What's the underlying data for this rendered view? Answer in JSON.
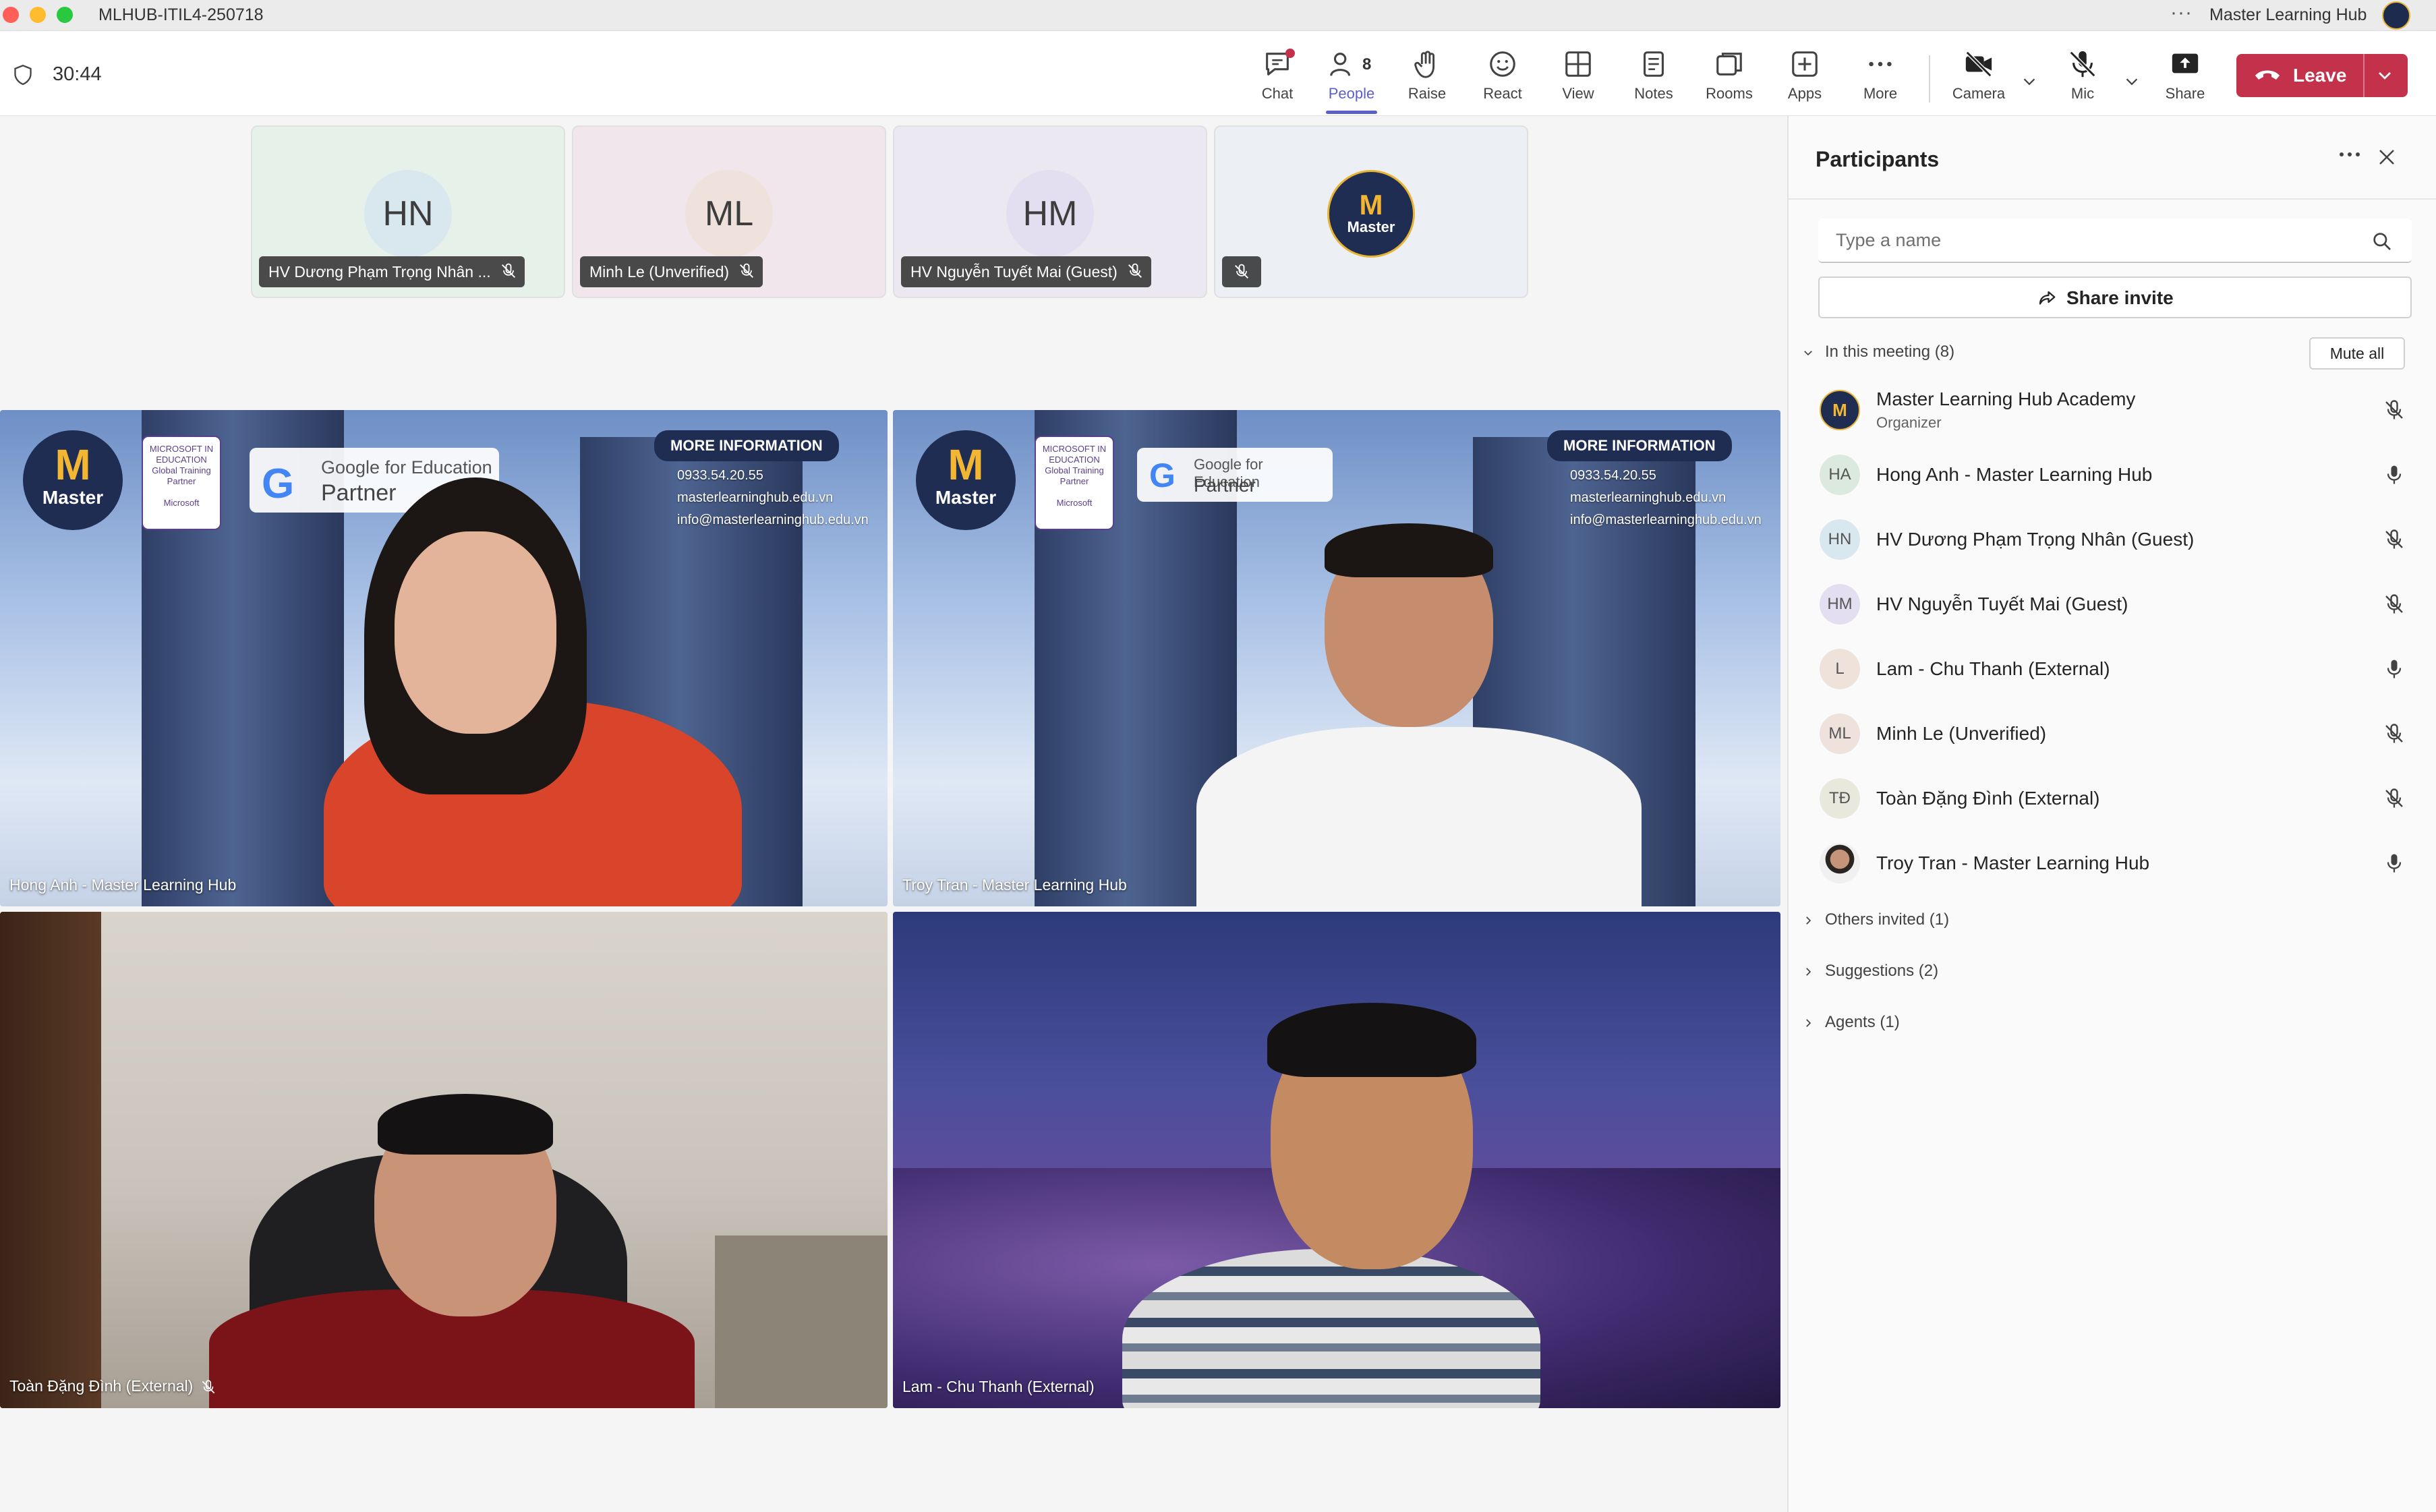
{
  "window": {
    "title": "MLHUB-ITIL4-250718",
    "org_name": "Master Learning Hub"
  },
  "toolbar": {
    "timer": "30:44",
    "chat_label": "Chat",
    "people_label": "People",
    "people_count": "8",
    "raise_label": "Raise",
    "react_label": "React",
    "view_label": "View",
    "notes_label": "Notes",
    "rooms_label": "Rooms",
    "apps_label": "Apps",
    "more_label": "More",
    "camera_label": "Camera",
    "mic_label": "Mic",
    "share_label": "Share",
    "leave_label": "Leave",
    "leave_color": "#c4314b",
    "accent_color": "#5b5fc7"
  },
  "small_tiles": [
    {
      "initials": "HN",
      "name": "HV Dương Phạm Trọng Nhân ...",
      "bg": "#e6f1e9"
    },
    {
      "initials": "ML",
      "name": "Minh Le (Unverified)",
      "bg": "#f1e6ec"
    },
    {
      "initials": "HM",
      "name": "HV Nguyễn Tuyết Mai (Guest)",
      "bg": "#ece8f1"
    },
    {
      "initials": "",
      "name": "",
      "bg": "#eceff3"
    }
  ],
  "logo_text": {
    "m": "M",
    "word": "Master"
  },
  "branding": {
    "badge_text": "MICROSOFT IN EDUCATION Global Training Partner",
    "badge_footer": "Microsoft",
    "gfe_line1": "Google for Education",
    "gfe_line2": "Partner",
    "info_header": "MORE INFORMATION",
    "phone": "0933.54.20.55",
    "website": "masterlearninghub.edu.vn",
    "email": "info@masterlearninghub.edu.vn"
  },
  "videos": [
    {
      "label": "Hong Anh - Master Learning Hub"
    },
    {
      "label": "Troy Tran - Master Learning Hub"
    },
    {
      "label": "Toàn Đặng Đình (External)"
    },
    {
      "label": "Lam - Chu Thanh (External)"
    }
  ],
  "panel": {
    "title": "Participants",
    "search_placeholder": "Type a name",
    "share_invite_label": "Share invite",
    "in_meeting_label": "In this meeting (8)",
    "mute_all_label": "Mute all",
    "participants": [
      {
        "initials": "",
        "name": "Master Learning Hub Academy",
        "role": "Organizer",
        "mic": "muted"
      },
      {
        "initials": "HA",
        "name": "Hong Anh - Master Learning Hub",
        "role": "",
        "mic": "on"
      },
      {
        "initials": "HN",
        "name": "HV Dương Phạm Trọng Nhân (Guest)",
        "role": "",
        "mic": "muted"
      },
      {
        "initials": "HM",
        "name": "HV Nguyễn Tuyết Mai (Guest)",
        "role": "",
        "mic": "muted"
      },
      {
        "initials": "L",
        "name": "Lam - Chu Thanh (External)",
        "role": "",
        "mic": "on"
      },
      {
        "initials": "ML",
        "name": "Minh Le (Unverified)",
        "role": "",
        "mic": "muted"
      },
      {
        "initials": "TĐ",
        "name": "Toàn Đặng Đình (External)",
        "role": "",
        "mic": "muted"
      },
      {
        "initials": "",
        "name": "Troy Tran - Master Learning Hub",
        "role": "",
        "mic": "on"
      }
    ],
    "others_invited_label": "Others invited (1)",
    "suggestions_label": "Suggestions (2)",
    "agents_label": "Agents (1)"
  }
}
